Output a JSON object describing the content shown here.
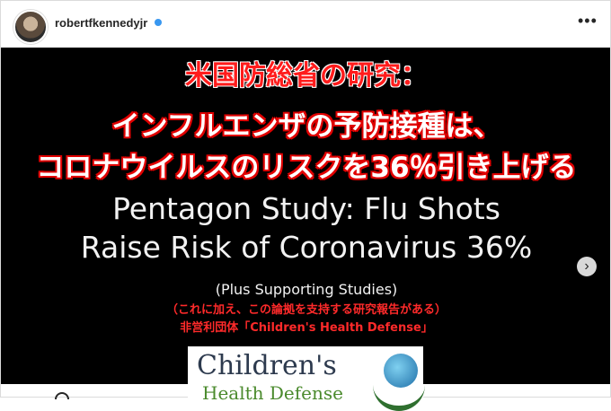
{
  "header": {
    "username": "robertfkennedyjr",
    "more_icon": "•••"
  },
  "image": {
    "jp_title_line1": "米国防総省の研究：",
    "jp_title_line2": "インフルエンザの予防接種は、",
    "jp_title_line3": "コロナウイルスのリスクを36％引き上げる",
    "en_title_line1": "Pentagon Study: Flu Shots",
    "en_title_line2": "Raise Risk of Coronavirus 36%",
    "en_subtitle": "(Plus Supporting Studies)",
    "jp_subtitle_line1": "（これに加え、この論拠を支持する研究報告がある）",
    "jp_subtitle_line2": "非営利団体「Children's Health Defense」",
    "logo_line1": "Children's",
    "logo_line2": "Health Defense"
  },
  "controls": {
    "next_icon": "›"
  }
}
